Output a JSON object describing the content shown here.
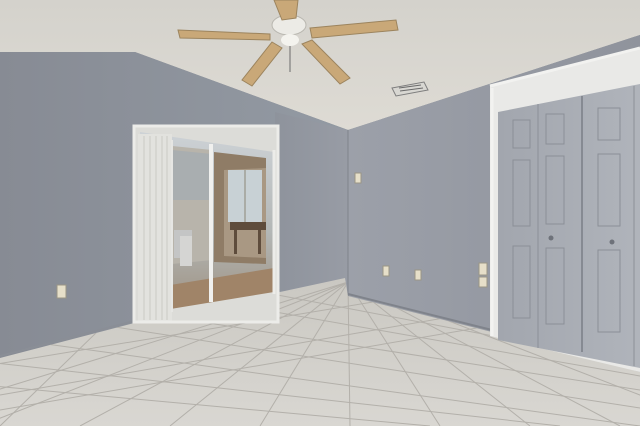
{
  "scene": {
    "kind": "empty-room-interior",
    "features": [
      "textured-ceiling",
      "ceiling-fan",
      "sliding-glass-door",
      "bifold-closet-doors",
      "tile-floor",
      "wall-outlets",
      "hvac-vent"
    ]
  },
  "colors": {
    "ceiling": "#d9d6cf",
    "left_wall": "#8c9099",
    "right_wall": "#9599a2",
    "floor_tile": "#d2d0cb",
    "grout": "#b7b4ae",
    "closet_door": "#a6aab2",
    "trim": "#e8e8e6",
    "fan_blade": "#c7a776"
  }
}
